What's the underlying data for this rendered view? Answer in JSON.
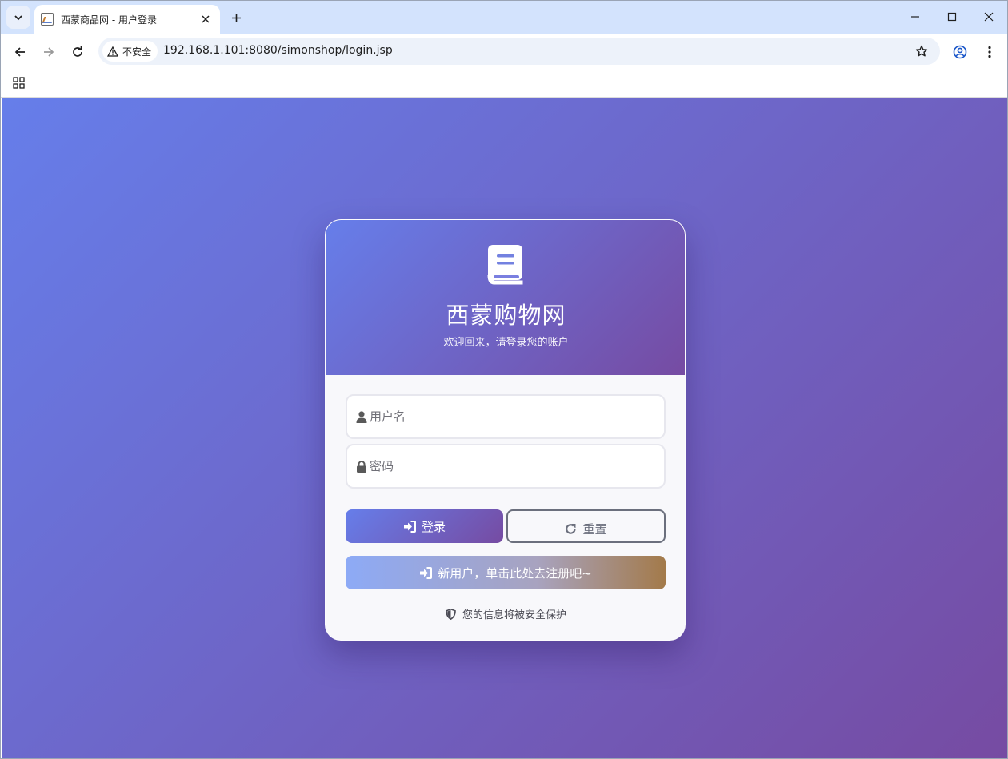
{
  "browser": {
    "tab_title": "西蒙商品网 - 用户登录",
    "security_label": "不安全",
    "url": "192.168.1.101:8080/simonshop/login.jsp"
  },
  "page": {
    "brand": "西蒙购物网",
    "subtitle": "欢迎回来，请登录您的账户",
    "username_placeholder": "用户名",
    "password_placeholder": "密码",
    "login_label": "登录",
    "reset_label": "重置",
    "register_label": "新用户，单击此处去注册吧~",
    "secure_note": "您的信息将被安全保护"
  },
  "colors": {
    "gradient_start": "#667eea",
    "gradient_end": "#764ba2",
    "register_gradient_end": "#a37a4a"
  }
}
